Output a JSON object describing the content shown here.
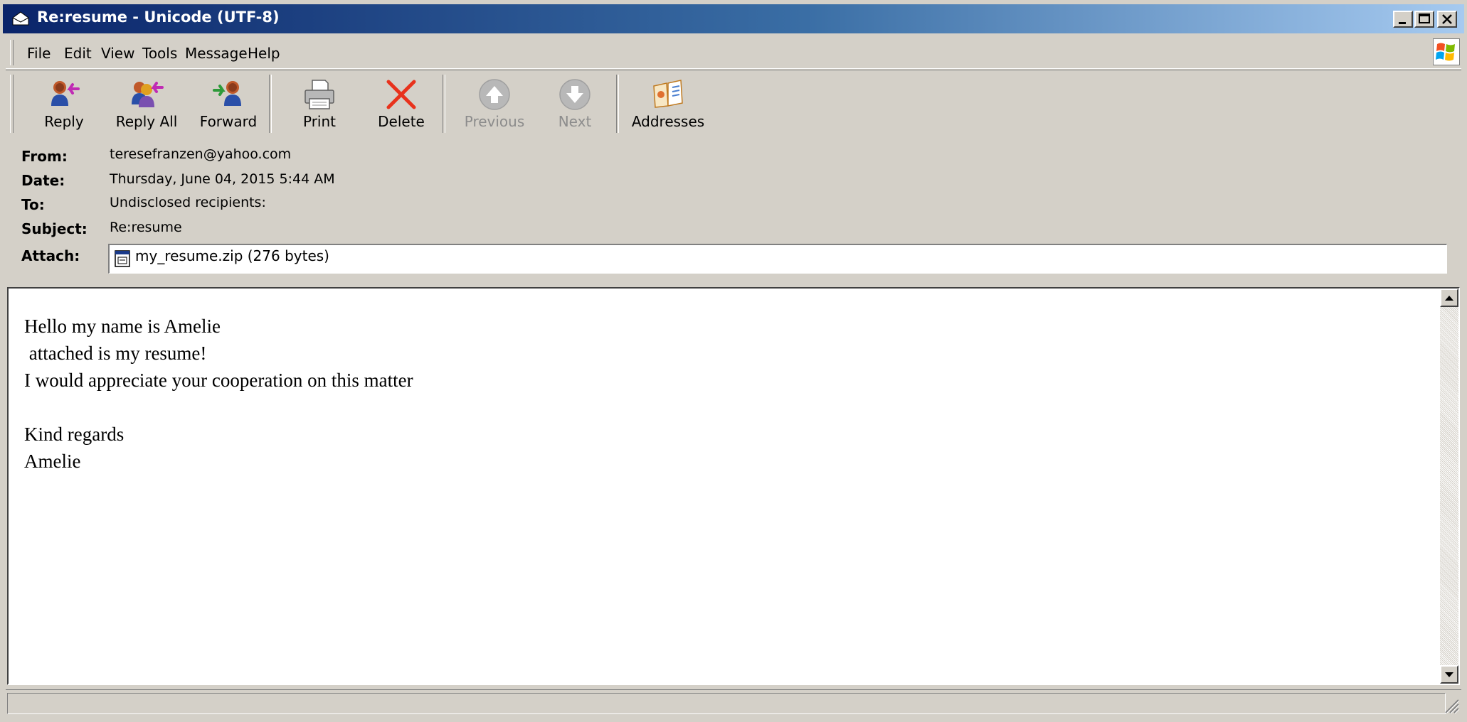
{
  "window": {
    "title": "Re:resume - Unicode (UTF-8)"
  },
  "menu": [
    "File",
    "Edit",
    "View",
    "Tools",
    "Message",
    "Help"
  ],
  "toolbar": {
    "reply": "Reply",
    "reply_all": "Reply All",
    "forward": "Forward",
    "print": "Print",
    "delete": "Delete",
    "previous": "Previous",
    "next": "Next",
    "addresses": "Addresses"
  },
  "header": {
    "from_label": "From:",
    "from": "teresefranzen@yahoo.com",
    "date_label": "Date:",
    "date": "Thursday, June 04, 2015 5:44 AM",
    "to_label": "To:",
    "to": "Undisclosed recipients:",
    "subject_label": "Subject:",
    "subject": "Re:resume",
    "attach_label": "Attach:",
    "attachment": "my_resume.zip (276 bytes)"
  },
  "body": {
    "text": "Hello my name is Amelie\n attached is my resume!\nI would appreciate your cooperation on this matter\n\nKind regards\nAmelie"
  },
  "colors": {
    "title_bar_start": "#0a246a",
    "title_bar_end": "#a6caf0",
    "chrome": "#d4d0c8",
    "delete_icon": "#e8321c",
    "disabled_text": "#8c8c8c"
  }
}
